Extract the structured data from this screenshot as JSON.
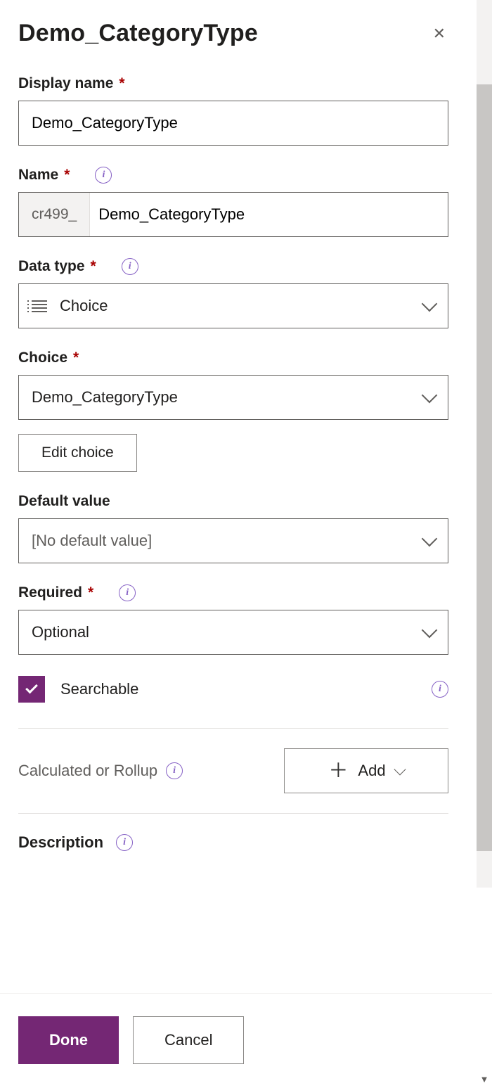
{
  "header": {
    "title": "Demo_CategoryType"
  },
  "fields": {
    "displayName": {
      "label": "Display name",
      "value": "Demo_CategoryType"
    },
    "name": {
      "label": "Name",
      "prefix": "cr499_",
      "value": "Demo_CategoryType"
    },
    "dataType": {
      "label": "Data type",
      "value": "Choice"
    },
    "choice": {
      "label": "Choice",
      "value": "Demo_CategoryType",
      "editButton": "Edit choice"
    },
    "defaultValue": {
      "label": "Default value",
      "value": "[No default value]"
    },
    "required": {
      "label": "Required",
      "value": "Optional"
    },
    "searchable": {
      "label": "Searchable",
      "checked": true
    },
    "rollup": {
      "label": "Calculated or Rollup",
      "addButton": "Add"
    },
    "description": {
      "label": "Description"
    }
  },
  "footer": {
    "done": "Done",
    "cancel": "Cancel"
  }
}
